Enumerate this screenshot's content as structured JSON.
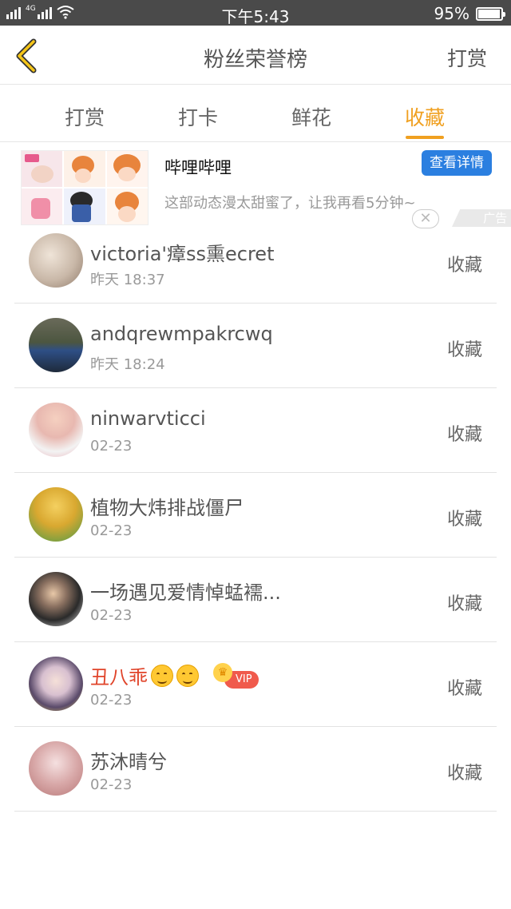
{
  "status_bar": {
    "network": "4G",
    "time": "下午5:43",
    "battery_percent": "95%",
    "battery_level": 0.95
  },
  "header": {
    "back_icon": "chevron-left-icon",
    "title": "粉丝荣誉榜",
    "right_link": "打赏",
    "accent_color": "#f0a020"
  },
  "tabs": [
    {
      "label": "打赏",
      "active": false
    },
    {
      "label": "打卡",
      "active": false
    },
    {
      "label": "鲜花",
      "active": false
    },
    {
      "label": "收藏",
      "active": true
    }
  ],
  "ad": {
    "title": "哔哩哔哩",
    "button": "查看详情",
    "description": "这部动态漫太甜蜜了，让我再看5分钟~",
    "tag": "广告",
    "close_icon": "close-icon",
    "button_color": "#2b7fe0"
  },
  "rows": [
    {
      "name": "victoria'瘴ss熏ecret",
      "time": "昨天 18:37",
      "action": "收藏",
      "avatar_color": "#c9b8a8"
    },
    {
      "name": "andqrewmpakrcwq",
      "time": "昨天 18:24",
      "action": "收藏",
      "avatar_color": "#3b4a5c"
    },
    {
      "name": "ninwarvticci",
      "time": "02-23",
      "action": "收藏",
      "avatar_color": "#e8b8b0"
    },
    {
      "name": "植物大炜排战僵尸",
      "time": "02-23",
      "action": "收藏",
      "avatar_color": "#d9a830"
    },
    {
      "name": "一场遇见爱情悼蜢襦...",
      "time": "02-23",
      "action": "收藏",
      "avatar_color": "#4a4a4a"
    },
    {
      "name": "丑八乖",
      "time": "02-23",
      "action": "收藏",
      "avatar_color": "#8a7fa0",
      "vip": "VIP"
    },
    {
      "name": "苏沐晴兮",
      "time": "02-23",
      "action": "收藏",
      "avatar_color": "#d8a8a8"
    }
  ]
}
